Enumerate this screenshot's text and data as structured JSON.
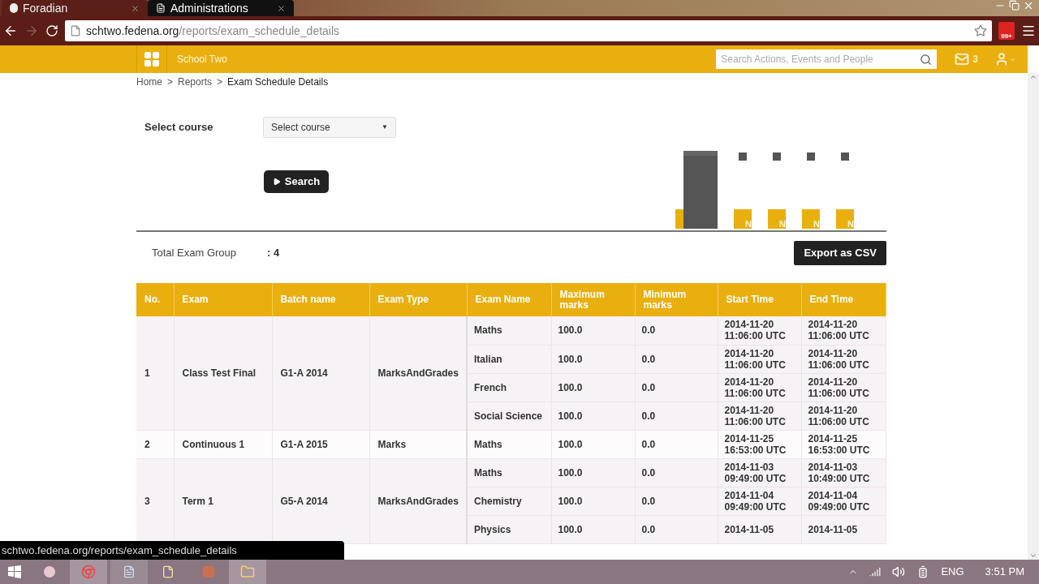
{
  "browser": {
    "tabs": [
      {
        "title": "Foradian",
        "selected": false
      },
      {
        "title": "Administrations",
        "selected": true
      }
    ],
    "url_host": "schtwo.fedena.org",
    "url_path": "/reports/exam_schedule_details",
    "extension_badge": "99+",
    "status_url": "schtwo.fedena.org/reports/exam_schedule_details"
  },
  "header": {
    "school": "School Two",
    "search_placeholder": "Search Actions, Events and People",
    "messages": "3"
  },
  "breadcrumb": [
    "Home",
    ">",
    "Reports",
    ">",
    "Exam Schedule Details"
  ],
  "filter": {
    "label": "Select course",
    "select_value": "Select course",
    "select_caret": "▼",
    "search_button": "Search"
  },
  "chart_labels": [
    "N",
    "N",
    "N",
    "N"
  ],
  "summary": {
    "label": "Total Exam Group",
    "value": ": 4"
  },
  "export_button": "Export as CSV",
  "table": {
    "columns": [
      "No.",
      "Exam",
      "Batch name",
      "Exam Type",
      "Exam Name",
      "Maximum marks",
      "Minimum marks",
      "Start Time",
      "End Time"
    ],
    "groups": [
      {
        "no": "1",
        "exam": "Class Test Final",
        "batch": "G1-A 2014",
        "type": "MarksAndGrades",
        "subjects": [
          {
            "name": "Maths",
            "max": "100.0",
            "min": "0.0",
            "start": "2014-11-20\n11:06:00 UTC",
            "end": "2014-11-20\n11:06:00 UTC"
          },
          {
            "name": "Italian",
            "max": "100.0",
            "min": "0.0",
            "start": "2014-11-20\n11:06:00 UTC",
            "end": "2014-11-20\n11:06:00 UTC"
          },
          {
            "name": "French",
            "max": "100.0",
            "min": "0.0",
            "start": "2014-11-20\n11:06:00 UTC",
            "end": "2014-11-20\n11:06:00 UTC"
          },
          {
            "name": "Social Science",
            "max": "100.0",
            "min": "0.0",
            "start": "2014-11-20\n11:06:00 UTC",
            "end": "2014-11-20\n11:06:00 UTC"
          }
        ]
      },
      {
        "no": "2",
        "exam": "Continuous 1",
        "batch": "G1-A 2015",
        "type": "Marks",
        "subjects": [
          {
            "name": "Maths",
            "max": "100.0",
            "min": "0.0",
            "start": "2014-11-25\n16:53:00 UTC",
            "end": "2014-11-25\n16:53:00 UTC"
          }
        ]
      },
      {
        "no": "3",
        "exam": "Term 1",
        "batch": "G5-A 2014",
        "type": "MarksAndGrades",
        "subjects": [
          {
            "name": "Maths",
            "max": "100.0",
            "min": "0.0",
            "start": "2014-11-03\n09:49:00 UTC",
            "end": "2014-11-03\n10:49:00 UTC"
          },
          {
            "name": "Chemistry",
            "max": "100.0",
            "min": "0.0",
            "start": "2014-11-04\n09:49:00 UTC",
            "end": "2014-11-04\n09:49:00 UTC"
          },
          {
            "name": "Physics",
            "max": "100.0",
            "min": "0.0",
            "start": "2014-11-05",
            "end": "2014-11-05"
          }
        ]
      }
    ]
  },
  "taskbar": {
    "language": "ENG",
    "time": "3:51 PM"
  }
}
